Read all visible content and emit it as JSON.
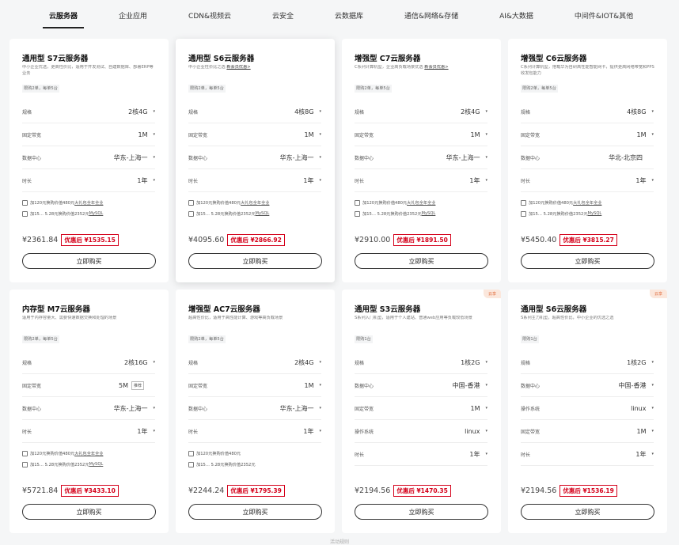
{
  "tabs": [
    "云服务器",
    "企业应用",
    "CDN&视频云",
    "云安全",
    "云数据库",
    "通信&网络&存储",
    "AI&大数据",
    "中间件&IOT&其他"
  ],
  "active_tab": 0,
  "cards": [
    {
      "title": "通用型 S7云服务器",
      "desc": "中小企业优选，更高性价比，适用于开发测试、自建数据库、部署ERP等业务",
      "desc_link": "",
      "limit": "限购2单，每单5台",
      "badge": "",
      "hover": false,
      "specs": [
        {
          "label": "规格",
          "value": "2核4G",
          "dropdown": true
        },
        {
          "label": "固定带宽",
          "value": "1M",
          "dropdown": true
        },
        {
          "label": "数据中心",
          "value": "华东-上海一",
          "dropdown": true
        },
        {
          "label": "时长",
          "value": "1年",
          "dropdown": true
        }
      ],
      "checks": [
        {
          "pre": "加120元换购价值480元",
          "link": "大礼包全年全业",
          "post": ""
        },
        {
          "pre": "加15… 5.28元换购价值2352元",
          "link": "MySQL",
          "post": ""
        }
      ],
      "price": "¥2361.84",
      "discount": "优惠后 ¥1535.15",
      "buy": "立即购买"
    },
    {
      "title": "通用型 S6云服务器",
      "desc": "中小企业性价比之选",
      "desc_link": "新会员优惠>",
      "limit": "限购2单，每单5台",
      "badge": "",
      "hover": true,
      "specs": [
        {
          "label": "规格",
          "value": "4核8G",
          "dropdown": true
        },
        {
          "label": "固定带宽",
          "value": "1M",
          "dropdown": true
        },
        {
          "label": "数据中心",
          "value": "华东-上海一",
          "dropdown": true
        },
        {
          "label": "时长",
          "value": "1年",
          "dropdown": true
        }
      ],
      "checks": [
        {
          "pre": "加120元换购价值480元",
          "link": "大礼包全年全业",
          "post": ""
        },
        {
          "pre": "加15… 5.28元换购价值2352元",
          "link": "MySQL",
          "post": ""
        }
      ],
      "price": "¥4095.60",
      "discount": "优惠后 ¥2866.92",
      "buy": "立即购买"
    },
    {
      "title": "增强型 C7云服务器",
      "desc": "C系列计算机型，企业高负载场景优选",
      "desc_link": "新会员优惠>",
      "limit": "限购2单，每单5台",
      "badge": "",
      "hover": false,
      "specs": [
        {
          "label": "规格",
          "value": "2核4G",
          "dropdown": true
        },
        {
          "label": "固定带宽",
          "value": "1M",
          "dropdown": true
        },
        {
          "label": "数据中心",
          "value": "华东-上海一",
          "dropdown": true
        },
        {
          "label": "时长",
          "value": "1年",
          "dropdown": true
        }
      ],
      "checks": [
        {
          "pre": "加120元换购价值480元",
          "link": "大礼包全年全业",
          "post": ""
        },
        {
          "pre": "加15… 5.28元换购价值2352元",
          "link": "MySQL",
          "post": ""
        }
      ],
      "price": "¥2910.00",
      "discount": "优惠后 ¥1891.50",
      "buy": "立即购买"
    },
    {
      "title": "增强型 C6云服务器",
      "desc": "C系列计算机型，搭载华为自研高性能智能网卡，提供更高网络带宽和PPS收发包能力",
      "desc_link": "",
      "limit": "限购2单，每单5台",
      "badge": "",
      "hover": false,
      "specs": [
        {
          "label": "规格",
          "value": "4核8G",
          "dropdown": true
        },
        {
          "label": "固定带宽",
          "value": "1M",
          "dropdown": true
        },
        {
          "label": "数据中心",
          "value": "华北-北京四",
          "dropdown": false
        },
        {
          "label": "时长",
          "value": "1年",
          "dropdown": true
        }
      ],
      "checks": [
        {
          "pre": "加120元换购价值480元",
          "link": "大礼包全年全业",
          "post": ""
        },
        {
          "pre": "加15… 5.28元换购价值2352元",
          "link": "MySQL",
          "post": ""
        }
      ],
      "price": "¥5450.40",
      "discount": "优惠后 ¥3815.27",
      "buy": "立即购买"
    },
    {
      "title": "内存型 M7云服务器",
      "desc": "适用于内存容量大、需要快速数据交换和处理的场景",
      "desc_link": "",
      "limit": "限购2单，每单5台",
      "badge": "",
      "hover": false,
      "specs": [
        {
          "label": "规格",
          "value": "2核16G",
          "dropdown": true
        },
        {
          "label": "固定带宽",
          "value": "5M",
          "dropdown": false,
          "chip": "推荐"
        },
        {
          "label": "数据中心",
          "value": "华东-上海一",
          "dropdown": true
        },
        {
          "label": "时长",
          "value": "1年",
          "dropdown": true
        }
      ],
      "checks": [
        {
          "pre": "加120元换购价值480元",
          "link": "大礼包全年全业",
          "post": ""
        },
        {
          "pre": "加15… 5.28元换购价值2352元",
          "link": "MySQL",
          "post": ""
        }
      ],
      "price": "¥5721.84",
      "discount": "优惠后 ¥3433.10",
      "buy": "立即购买"
    },
    {
      "title": "增强型 AC7云服务器",
      "desc": "超高性价比，适用于高性能计算、游戏等高负载场景",
      "desc_link": "",
      "limit": "限购2单，每单5台",
      "badge": "",
      "hover": false,
      "specs": [
        {
          "label": "规格",
          "value": "2核4G",
          "dropdown": true
        },
        {
          "label": "固定带宽",
          "value": "1M",
          "dropdown": true
        },
        {
          "label": "数据中心",
          "value": "华东-上海一",
          "dropdown": true
        },
        {
          "label": "时长",
          "value": "1年",
          "dropdown": true
        }
      ],
      "checks": [
        {
          "pre": "加120元换购价值480元",
          "link": "",
          "post": ""
        },
        {
          "pre": "加15… 5.28元换购价值2352元",
          "link": "",
          "post": ""
        }
      ],
      "price": "¥2244.24",
      "discount": "优惠后 ¥1795.39",
      "buy": "立即购买"
    },
    {
      "title": "通用型 S3云服务器",
      "desc": "S系列入门机型，适用于个人建站、普通web应用等负载较低场景",
      "desc_link": "",
      "limit": "限购1台",
      "badge": "云享",
      "hover": false,
      "specs": [
        {
          "label": "规格",
          "value": "1核2G",
          "dropdown": true
        },
        {
          "label": "数据中心",
          "value": "中国-香港",
          "dropdown": true
        },
        {
          "label": "固定带宽",
          "value": "1M",
          "dropdown": true
        },
        {
          "label": "操作系统",
          "value": "linux",
          "dropdown": true
        },
        {
          "label": "时长",
          "value": "1年",
          "dropdown": true
        }
      ],
      "checks": [],
      "price": "¥2194.56",
      "discount": "优惠后 ¥1470.35",
      "buy": "立即购买"
    },
    {
      "title": "通用型 S6云服务器",
      "desc": "S系列主力机型，超高性价比，中小企业的优选之选",
      "desc_link": "",
      "limit": "限购1台",
      "badge": "云享",
      "hover": false,
      "specs": [
        {
          "label": "规格",
          "value": "1核2G",
          "dropdown": true
        },
        {
          "label": "数据中心",
          "value": "中国-香港",
          "dropdown": true
        },
        {
          "label": "操作系统",
          "value": "linux",
          "dropdown": true
        },
        {
          "label": "固定带宽",
          "value": "1M",
          "dropdown": true
        },
        {
          "label": "时长",
          "value": "1年",
          "dropdown": true
        }
      ],
      "checks": [],
      "price": "¥2194.56",
      "discount": "优惠后 ¥1536.19",
      "buy": "立即购买"
    }
  ],
  "footer_text": "活动规则"
}
